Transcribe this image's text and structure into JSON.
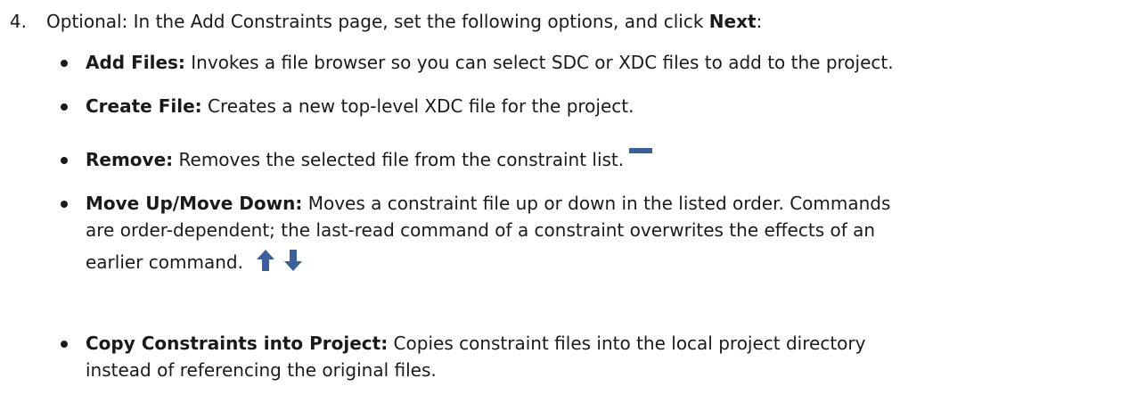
{
  "step": {
    "number": "4.",
    "text_before": "Optional: In the Add Constraints page, set the following options, and click ",
    "bold": "Next",
    "text_after": ":"
  },
  "bullets": [
    {
      "label": "Add Files:",
      "text": " Invokes a file browser so you can select SDC or XDC files to add to the project."
    },
    {
      "label": "Create File:",
      "text": " Creates a new top-level XDC file for the project."
    },
    {
      "label": "Remove:",
      "text": " Removes the selected file from the constraint list.",
      "icon": "remove-bar-icon"
    },
    {
      "label": "Move Up/Move Down:",
      "text_line1": " Moves a constraint file up or down in the listed order. Commands",
      "text_line2": "are order-dependent; the last-read command of a constraint overwrites the effects of an",
      "text_line3": "earlier command.",
      "icons": [
        "arrow-up-icon",
        "arrow-down-icon"
      ]
    },
    {
      "label": "Copy Constraints into Project:",
      "text_line1": " Copies constraint files into the local project directory",
      "text_line2": "instead of referencing the original files."
    }
  ],
  "colors": {
    "text": "#1a1a1a",
    "icon_blue": "#3b5f9b"
  }
}
